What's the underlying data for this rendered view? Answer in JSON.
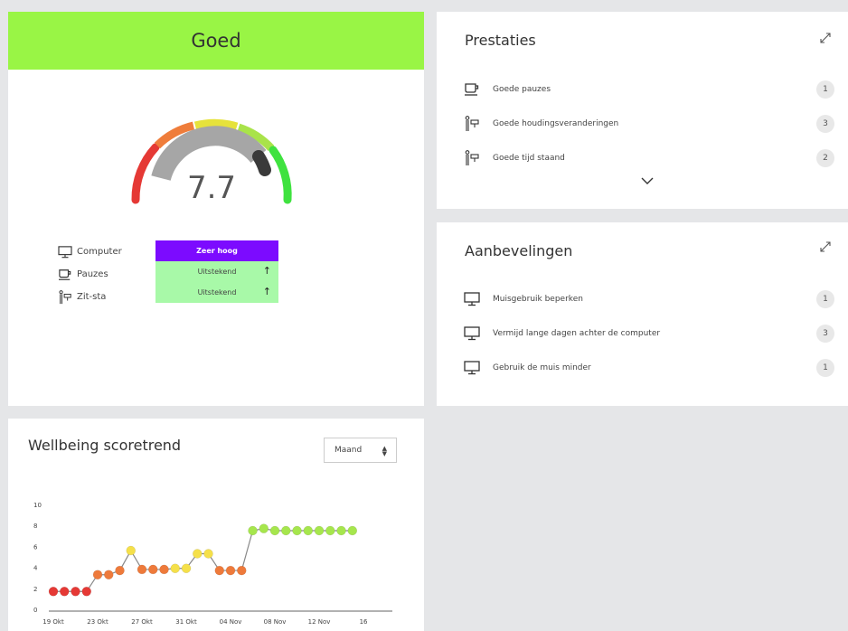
{
  "score_card": {
    "status": "Goed",
    "score": "7.7",
    "score_value": 7.7,
    "score_max": 10,
    "legend": [
      {
        "label": "Computer",
        "icon": "monitor-icon"
      },
      {
        "label": "Pauzes",
        "icon": "cup-icon"
      },
      {
        "label": "Zit-sta",
        "icon": "sit-stand-icon"
      }
    ],
    "levels": [
      {
        "label": "Zeer hoog",
        "color": "#7c0bff",
        "arrow": ""
      },
      {
        "label": "Uitstekend",
        "color": "#a8f9a8",
        "arrow": "↑"
      },
      {
        "label": "Uitstekend",
        "color": "#a8f9a8",
        "arrow": "↑"
      }
    ],
    "banner_color": "#99f545"
  },
  "prestaties": {
    "title": "Prestaties",
    "items": [
      {
        "label": "Goede pauzes",
        "count": "1",
        "icon": "cup-icon"
      },
      {
        "label": "Goede houdingsveranderingen",
        "count": "3",
        "icon": "sit-stand-icon"
      },
      {
        "label": "Goede tijd staand",
        "count": "2",
        "icon": "sit-stand-icon"
      }
    ]
  },
  "aanbevelingen": {
    "title": "Aanbevelingen",
    "items": [
      {
        "label": "Muisgebruik beperken",
        "count": "1",
        "icon": "monitor-icon"
      },
      {
        "label": "Vermijd lange dagen achter de computer",
        "count": "3",
        "icon": "monitor-icon"
      },
      {
        "label": "Gebruik de muis minder",
        "count": "1",
        "icon": "monitor-icon"
      }
    ]
  },
  "trend": {
    "title": "Wellbeing scoretrend",
    "period": "Maand"
  },
  "chart_data": {
    "type": "line",
    "title": "Wellbeing scoretrend",
    "ylim": [
      0,
      10
    ],
    "yticks": [
      "0",
      "2",
      "4",
      "6",
      "8",
      "10"
    ],
    "xticks": [
      "19 Okt",
      "23 Okt",
      "27 Okt",
      "31 Okt",
      "04 Nov",
      "08 Nov",
      "12 Nov",
      "16"
    ],
    "grid": false,
    "series": [
      {
        "x": [
          "19 Okt",
          "20 Okt",
          "21 Okt",
          "22 Okt",
          "23 Okt",
          "24 Okt",
          "25 Okt",
          "26 Okt",
          "27 Okt",
          "28 Okt",
          "29 Okt",
          "30 Okt",
          "31 Okt",
          "01 Nov",
          "02 Nov",
          "03 Nov",
          "04 Nov",
          "05 Nov",
          "06 Nov",
          "07 Nov",
          "08 Nov",
          "09 Nov",
          "10 Nov",
          "11 Nov",
          "12 Nov",
          "13 Nov",
          "14 Nov",
          "15 Nov"
        ],
        "values": [
          1.7,
          1.7,
          1.7,
          1.7,
          3.3,
          3.3,
          3.7,
          5.6,
          3.8,
          3.8,
          3.8,
          3.9,
          3.9,
          5.3,
          5.3,
          3.7,
          3.7,
          3.7,
          7.5,
          7.7,
          7.5,
          7.5,
          7.5,
          7.5,
          7.5,
          7.5,
          7.5,
          7.5
        ],
        "colors": [
          "#e53935",
          "#e53935",
          "#e53935",
          "#e53935",
          "#ee7a3b",
          "#ee7a3b",
          "#ee7a3b",
          "#f5e04a",
          "#ee7a3b",
          "#ee7a3b",
          "#ee7a3b",
          "#f5e04a",
          "#f5e04a",
          "#f5e04a",
          "#f5e04a",
          "#ee7a3b",
          "#ee7a3b",
          "#ee7a3b",
          "#a6e64d",
          "#a6e64d",
          "#a6e64d",
          "#a6e64d",
          "#a6e64d",
          "#a6e64d",
          "#a6e64d",
          "#a6e64d",
          "#a6e64d",
          "#a6e64d"
        ]
      }
    ]
  }
}
